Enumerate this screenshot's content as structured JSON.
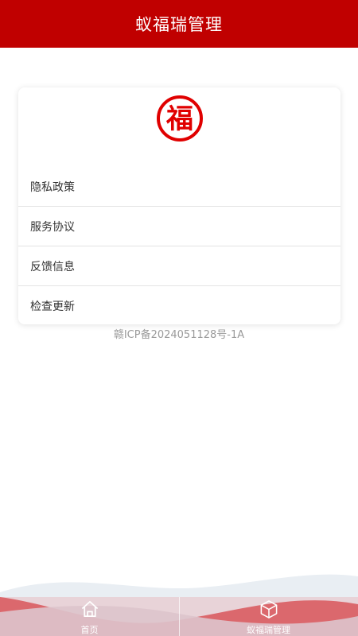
{
  "header": {
    "title": "蚁福瑞管理"
  },
  "logo": {
    "icon": "fu-seal-logo",
    "text": "福",
    "color": "#e00000"
  },
  "menu": {
    "items": [
      {
        "label": "隐私政策"
      },
      {
        "label": "服务协议"
      },
      {
        "label": "反馈信息"
      },
      {
        "label": "检查更新"
      }
    ]
  },
  "footer": {
    "icp": "赣ICP备2024051128号-1A"
  },
  "tabbar": {
    "tabs": [
      {
        "label": "首页",
        "icon": "home-icon"
      },
      {
        "label": "蚁福瑞管理",
        "icon": "cube-icon"
      }
    ]
  },
  "colors": {
    "primary": "#c00000",
    "tab_wave": "#d44a4a"
  }
}
